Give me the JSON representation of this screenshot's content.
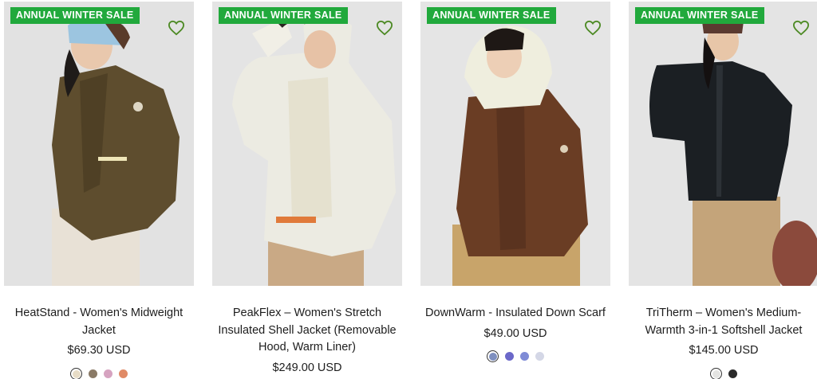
{
  "colors": {
    "badge": "#21a93c",
    "heart": "#4d8a24"
  },
  "products": [
    {
      "badge": "ANNUAL WINTER SALE",
      "wishlist_icon": "heart-outline-icon",
      "title_lines": [
        "HeatStand - Women's Midweight",
        "Jacket"
      ],
      "price": "$69.30 USD",
      "swatches": [
        "#e7dcc6",
        "#8a7a66",
        "#d6a3c0",
        "#e08a66"
      ],
      "selected_swatch": 0
    },
    {
      "badge": "ANNUAL WINTER SALE",
      "wishlist_icon": "heart-outline-icon",
      "title_lines": [
        "PeakFlex – Women's Stretch",
        "Insulated Shell Jacket (Removable",
        "Hood, Warm Liner)"
      ],
      "price": "$249.00 USD",
      "swatches": [],
      "selected_swatch": null
    },
    {
      "badge": "ANNUAL WINTER SALE",
      "wishlist_icon": "heart-outline-icon",
      "title_lines": [
        "DownWarm - Insulated Down Scarf"
      ],
      "price": "$49.00 USD",
      "swatches": [
        "#7e8fbf",
        "#6b68c9",
        "#7f8bd6",
        "#d4d7e6"
      ],
      "selected_swatch": 0
    },
    {
      "badge": "ANNUAL WINTER SALE",
      "wishlist_icon": "heart-outline-icon",
      "title_lines": [
        "TriTherm – Women's Medium-",
        "Warmth 3-in-1 Softshell Jacket"
      ],
      "price": "$145.00 USD",
      "swatches": [
        "#e4e4e2",
        "#2a2a2a"
      ],
      "selected_swatch": 0
    }
  ]
}
